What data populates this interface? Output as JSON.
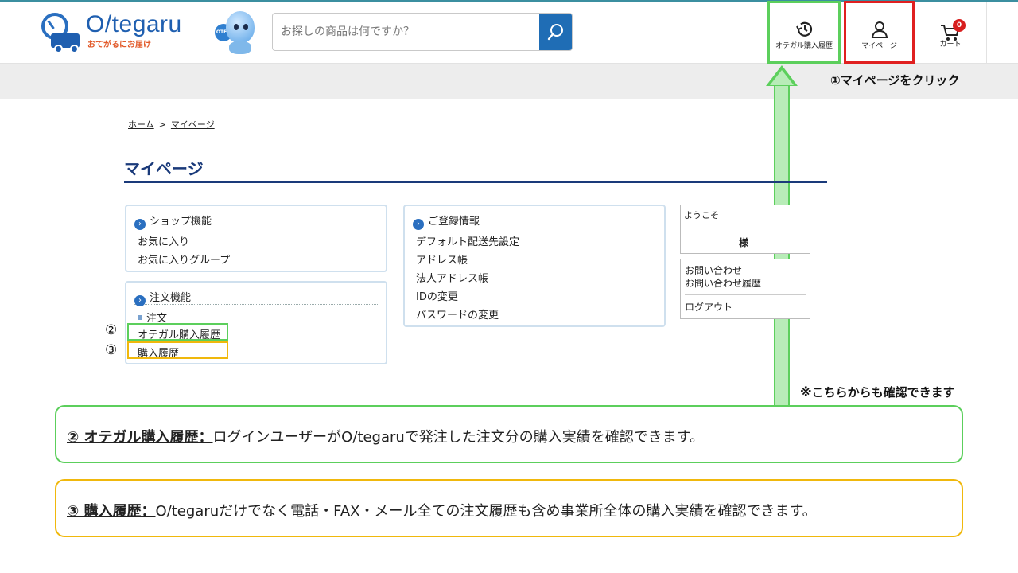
{
  "header": {
    "logo_text": "O/tegaru",
    "logo_sub": "おてがるにお届け",
    "mascot_badge": "OTEG",
    "search_placeholder": "お探しの商品は何ですか？",
    "nav": {
      "history_label": "オテガル購入履歴",
      "mypage_label": "マイページ",
      "cart_label": "カート",
      "cart_count": "0"
    }
  },
  "annotations": {
    "step1": "①マイページをクリック",
    "note": "※こちらからも確認できます",
    "mark2": "②",
    "mark3": "③"
  },
  "breadcrumb": {
    "home": "ホーム",
    "separator": ">",
    "current": "マイページ"
  },
  "page_title": "マイページ",
  "panels": {
    "shop": {
      "title": "ショップ機能",
      "items": [
        "お気に入り",
        "お気に入りグループ"
      ]
    },
    "order": {
      "title": "注文機能",
      "sub": "注文",
      "items": [
        "オテガル購入履歴",
        "購入履歴"
      ]
    },
    "registration": {
      "title": "ご登録情報",
      "items": [
        "デフォルト配送先設定",
        "アドレス帳",
        "法人アドレス帳",
        "IDの変更",
        "パスワードの変更"
      ]
    },
    "welcome": {
      "label": "ようこそ",
      "sama": "様"
    },
    "contact": {
      "items": [
        "お問い合わせ",
        "お問い合わせ履歴"
      ],
      "logout": "ログアウト"
    }
  },
  "callouts": {
    "green": {
      "title": "② オテガル購入履歴：",
      "body": "ログインユーザーがO/tegaruで発注した注文分の購入実績を確認できます。"
    },
    "yellow": {
      "title": "③ 購入履歴：",
      "body": "O/tegaruだけでなく電話・FAX・メール全ての注文履歴も含め事業所全体の購入実績を確認できます。"
    }
  },
  "colors": {
    "brand_blue": "#1f5fb0",
    "title_navy": "#1a3a7a",
    "green_highlight": "#5ccf5c",
    "red_highlight": "#e02020",
    "yellow_highlight": "#f0b80c"
  }
}
